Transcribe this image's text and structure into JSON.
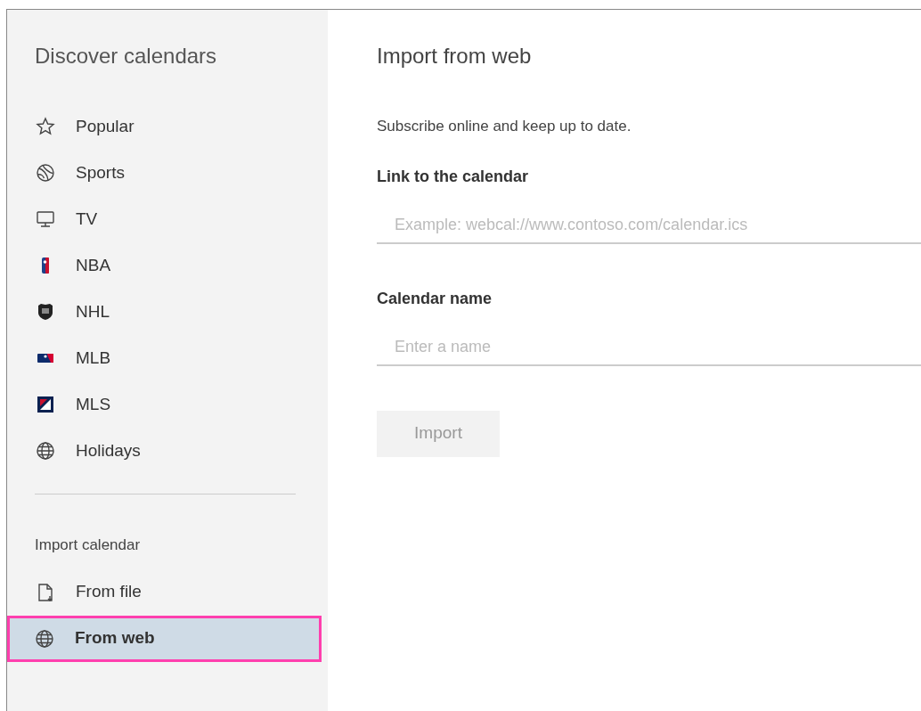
{
  "sidebar": {
    "title": "Discover calendars",
    "discover_items": [
      {
        "label": "Popular",
        "selected": false
      },
      {
        "label": "Sports",
        "selected": false
      },
      {
        "label": "TV",
        "selected": false
      },
      {
        "label": "NBA",
        "selected": false
      },
      {
        "label": "NHL",
        "selected": false
      },
      {
        "label": "MLB",
        "selected": false
      },
      {
        "label": "MLS",
        "selected": false
      },
      {
        "label": "Holidays",
        "selected": false
      }
    ],
    "import_heading": "Import calendar",
    "import_items": [
      {
        "label": "From file",
        "selected": false
      },
      {
        "label": "From web",
        "selected": true
      }
    ]
  },
  "main": {
    "title": "Import from web",
    "subtitle": "Subscribe online and keep up to date.",
    "fields": [
      {
        "label": "Link to the calendar",
        "placeholder": "Example: webcal://www.contoso.com/calendar.ics"
      },
      {
        "label": "Calendar name",
        "placeholder": "Enter a name"
      }
    ],
    "import_button": {
      "label": "Import",
      "disabled": true
    }
  }
}
